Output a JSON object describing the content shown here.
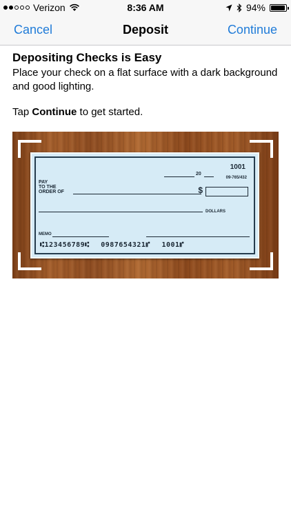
{
  "status_bar": {
    "carrier": "Verizon",
    "time": "8:36 AM",
    "battery": "94%",
    "battery_level": 0.94,
    "signal_bars_filled": 2,
    "signal_bars_total": 5
  },
  "nav": {
    "left_label": "Cancel",
    "title": "Deposit",
    "right_label": "Continue"
  },
  "content": {
    "heading": "Depositing Checks is Easy",
    "description": "Place your check on a flat surface with a dark background and good lighting.",
    "tap_prefix": "Tap ",
    "tap_bold": "Continue",
    "tap_suffix": " to get started."
  },
  "check": {
    "number": "1001",
    "date_suffix": "20",
    "routing_fraction": "09-765/432",
    "pay_label_1": "PAY",
    "pay_label_2": "TO THE",
    "pay_label_3": "ORDER OF",
    "dollar_sign": "$",
    "dollars_label": "DOLLARS",
    "memo_label": "MEMO",
    "micr_routing": "⑆123456789⑆",
    "micr_account": "0987654321⑈",
    "micr_check": "1001⑈"
  },
  "colors": {
    "accent": "#1f7bd8",
    "check_bg": "#d6ebf6",
    "wood": "#9a5426"
  }
}
